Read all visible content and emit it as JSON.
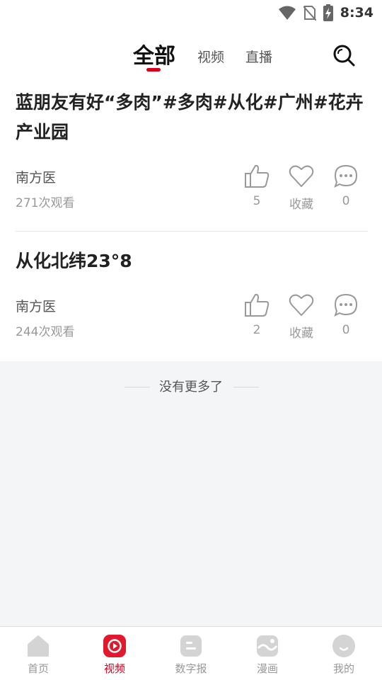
{
  "status_bar": {
    "time": "8:34"
  },
  "top_tabs": {
    "active": "全部",
    "tabs": [
      "视频",
      "直播"
    ]
  },
  "posts": [
    {
      "title": "蓝朋友有好“多肉”#多肉#从化#广州#花卉产业园",
      "source": "南方医",
      "views": "271次观看",
      "likes": "5",
      "collect_label": "收藏",
      "comments": "0"
    },
    {
      "title": "从化北纬23°8",
      "source": "南方医",
      "views": "244次观看",
      "likes": "2",
      "collect_label": "收藏",
      "comments": "0"
    }
  ],
  "footer_text": "没有更多了",
  "bottom_nav": [
    {
      "label": "首页",
      "icon": "home-icon"
    },
    {
      "label": "视频",
      "icon": "video-icon",
      "active": true
    },
    {
      "label": "数字报",
      "icon": "newspaper-icon"
    },
    {
      "label": "漫画",
      "icon": "comic-icon"
    },
    {
      "label": "我的",
      "icon": "profile-icon"
    }
  ],
  "colors": {
    "accent": "#d9001b",
    "background": "#f4f5f7",
    "icon_gray": "#d4d4d4"
  }
}
